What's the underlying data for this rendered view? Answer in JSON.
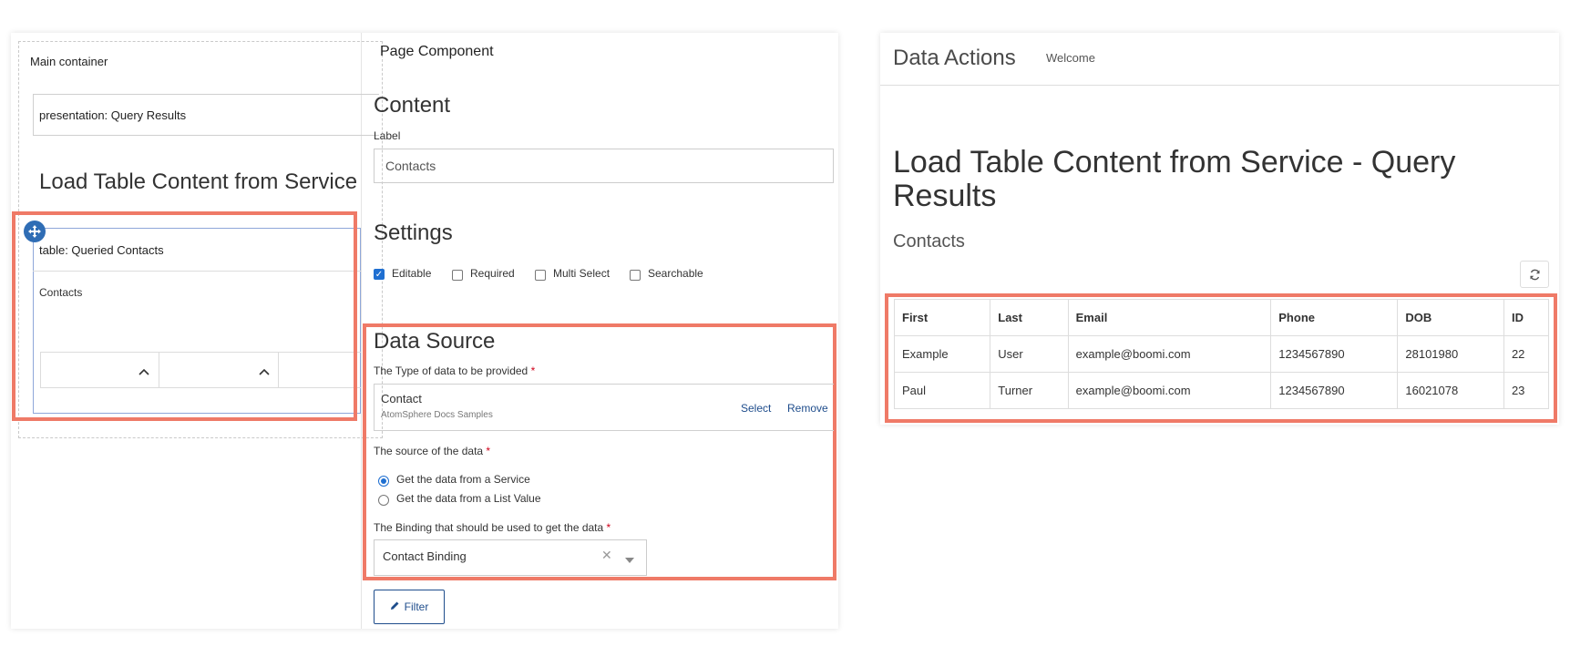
{
  "builder": {
    "main_container_label": "Main container",
    "presentation_label": "presentation: Query Results",
    "presentation_title": "Load Table Content from Service",
    "table_label": "table: Queried Contacts",
    "table_sublabel": "Contacts"
  },
  "properties": {
    "panel_title": "Page Component",
    "content_heading": "Content",
    "label_field_label": "Label",
    "label_field_value": "Contacts",
    "settings_heading": "Settings",
    "settings": [
      {
        "label": "Editable",
        "checked": true
      },
      {
        "label": "Required",
        "checked": false
      },
      {
        "label": "Multi Select",
        "checked": false
      },
      {
        "label": "Searchable",
        "checked": false
      }
    ],
    "data_source_heading": "Data Source",
    "type_label": "The Type of data to be provided",
    "type_value": "Contact",
    "type_subvalue": "AtomSphere Docs Samples",
    "select_link": "Select",
    "remove_link": "Remove",
    "source_label": "The source of the data",
    "source_options": [
      {
        "label": "Get the data from a Service",
        "selected": true
      },
      {
        "label": "Get the data from a List Value",
        "selected": false
      }
    ],
    "binding_label": "The Binding that should be used to get the data",
    "binding_value": "Contact Binding",
    "filter_button": "Filter",
    "required_marker": "*"
  },
  "runtime": {
    "app_title": "Data Actions",
    "welcome": "Welcome",
    "page_title": "Load Table Content from Service - Query Results",
    "subtitle": "Contacts",
    "columns": [
      "First",
      "Last",
      "Email",
      "Phone",
      "DOB",
      "ID"
    ],
    "rows": [
      [
        "Example",
        "User",
        "example@boomi.com",
        "1234567890",
        "28101980",
        "22"
      ],
      [
        "Paul",
        "Turner",
        "example@boomi.com",
        "1234567890",
        "16021078",
        "23"
      ]
    ]
  },
  "colors": {
    "highlight": "#ef7a67",
    "accent": "#1f6fd1"
  },
  "icons": {
    "move": "move-icon",
    "chevron": "chevron-up-icon",
    "clear": "clear-icon",
    "dropdown": "caret-down-icon",
    "pencil": "pencil-icon",
    "refresh": "refresh-icon"
  }
}
